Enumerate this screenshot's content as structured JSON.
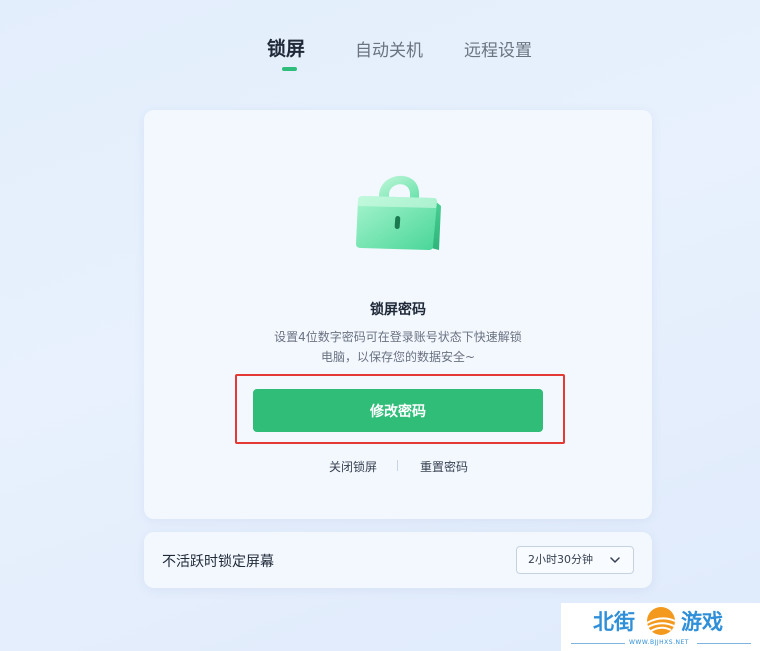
{
  "tabs": [
    {
      "label": "锁屏",
      "active": true
    },
    {
      "label": "自动关机",
      "active": false
    },
    {
      "label": "远程设置",
      "active": false
    }
  ],
  "lock_card": {
    "icon": "padlock-icon",
    "title": "锁屏密码",
    "description_line1": "设置4位数字密码可在登录账号状态下快速解锁",
    "description_line2": "电脑，以保存您的数据安全~",
    "primary_button": "修改密码",
    "link_close": "关闭锁屏",
    "link_reset": "重置密码"
  },
  "idle_lock": {
    "label": "不活跃时锁定屏幕",
    "selected_value": "2小时30分钟",
    "dropdown_icon": "chevron-down-icon"
  },
  "watermark": {
    "text_left": "北街",
    "text_right": "游戏",
    "subtext": "WWW.BJJHXS.NET"
  },
  "colors": {
    "accent": "#2fbd78",
    "highlight": "#e53935",
    "watermark": "#2f8fd8"
  }
}
